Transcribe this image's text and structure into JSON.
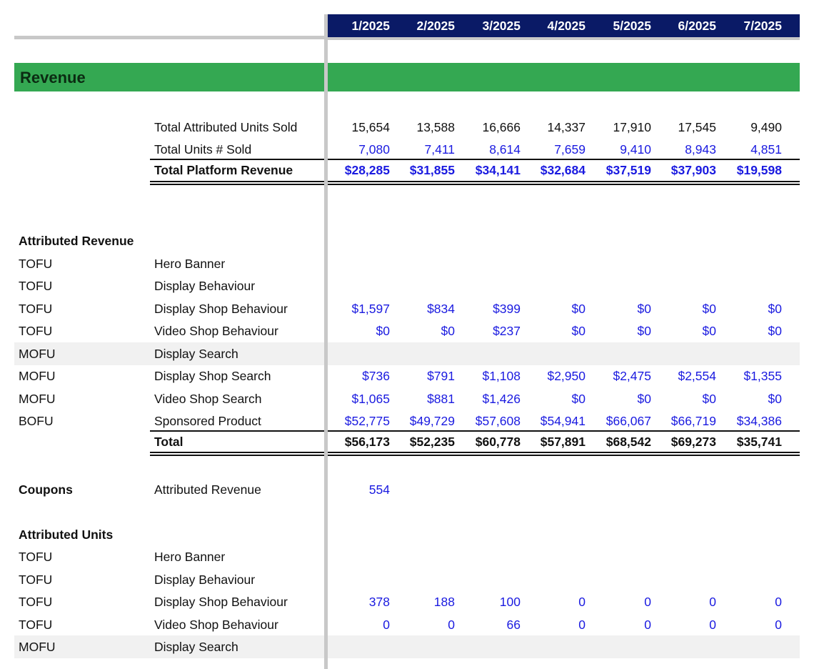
{
  "colors": {
    "header_bg": "#0a1a66",
    "section_bg": "#34a852",
    "input_blue": "#1a1ae0",
    "shade_row": "#f1f1f1"
  },
  "periods": [
    "1/2025",
    "2/2025",
    "3/2025",
    "4/2025",
    "5/2025",
    "6/2025",
    "7/2025"
  ],
  "section_title": "Revenue",
  "summary": [
    {
      "label": "Total Attributed Units Sold",
      "style": "black",
      "values": [
        "15,654",
        "13,588",
        "16,666",
        "14,337",
        "17,910",
        "17,545",
        "9,490"
      ]
    },
    {
      "label": "Total Units # Sold",
      "style": "blue",
      "values": [
        "7,080",
        "7,411",
        "8,614",
        "7,659",
        "9,410",
        "8,943",
        "4,851"
      ]
    },
    {
      "label": "Total Platform Revenue",
      "style": "blue-bold",
      "values": [
        "$28,285",
        "$31,855",
        "$34,141",
        "$32,684",
        "$37,519",
        "$37,903",
        "$19,598"
      ]
    }
  ],
  "attributed_revenue": {
    "title": "Attributed Revenue",
    "rows": [
      {
        "stage": "TOFU",
        "label": "Hero Banner",
        "values": [
          "",
          "",
          "",
          "",
          "",
          "",
          ""
        ]
      },
      {
        "stage": "TOFU",
        "label": "Display Behaviour",
        "values": [
          "",
          "",
          "",
          "",
          "",
          "",
          ""
        ]
      },
      {
        "stage": "TOFU",
        "label": "Display Shop Behaviour",
        "values": [
          "$1,597",
          "$834",
          "$399",
          "$0",
          "$0",
          "$0",
          "$0"
        ]
      },
      {
        "stage": "TOFU",
        "label": "Video Shop Behaviour",
        "values": [
          "$0",
          "$0",
          "$237",
          "$0",
          "$0",
          "$0",
          "$0"
        ]
      },
      {
        "stage": "MOFU",
        "label": "Display Search",
        "values": [
          "",
          "",
          "",
          "",
          "",
          "",
          ""
        ],
        "shaded": true
      },
      {
        "stage": "MOFU",
        "label": "Display Shop Search",
        "values": [
          "$736",
          "$791",
          "$1,108",
          "$2,950",
          "$2,475",
          "$2,554",
          "$1,355"
        ]
      },
      {
        "stage": "MOFU",
        "label": "Video Shop Search",
        "values": [
          "$1,065",
          "$881",
          "$1,426",
          "$0",
          "$0",
          "$0",
          "$0"
        ]
      },
      {
        "stage": "BOFU",
        "label": "Sponsored Product",
        "values": [
          "$52,775",
          "$49,729",
          "$57,608",
          "$54,941",
          "$66,067",
          "$66,719",
          "$34,386"
        ]
      }
    ],
    "total": {
      "label": "Total",
      "values": [
        "$56,173",
        "$52,235",
        "$60,778",
        "$57,891",
        "$68,542",
        "$69,273",
        "$35,741"
      ]
    }
  },
  "coupons": {
    "title": "Coupons",
    "label": "Attributed Revenue",
    "values": [
      "554",
      "",
      "",
      "",
      "",
      "",
      ""
    ]
  },
  "attributed_units": {
    "title": "Attributed Units",
    "rows": [
      {
        "stage": "TOFU",
        "label": "Hero Banner",
        "values": [
          "",
          "",
          "",
          "",
          "",
          "",
          ""
        ]
      },
      {
        "stage": "TOFU",
        "label": "Display Behaviour",
        "values": [
          "",
          "",
          "",
          "",
          "",
          "",
          ""
        ]
      },
      {
        "stage": "TOFU",
        "label": "Display Shop Behaviour",
        "values": [
          "378",
          "188",
          "100",
          "0",
          "0",
          "0",
          "0"
        ]
      },
      {
        "stage": "TOFU",
        "label": "Video Shop Behaviour",
        "values": [
          "0",
          "0",
          "66",
          "0",
          "0",
          "0",
          "0"
        ]
      },
      {
        "stage": "MOFU",
        "label": "Display Search",
        "values": [
          "",
          "",
          "",
          "",
          "",
          "",
          ""
        ],
        "shaded": true
      }
    ]
  }
}
